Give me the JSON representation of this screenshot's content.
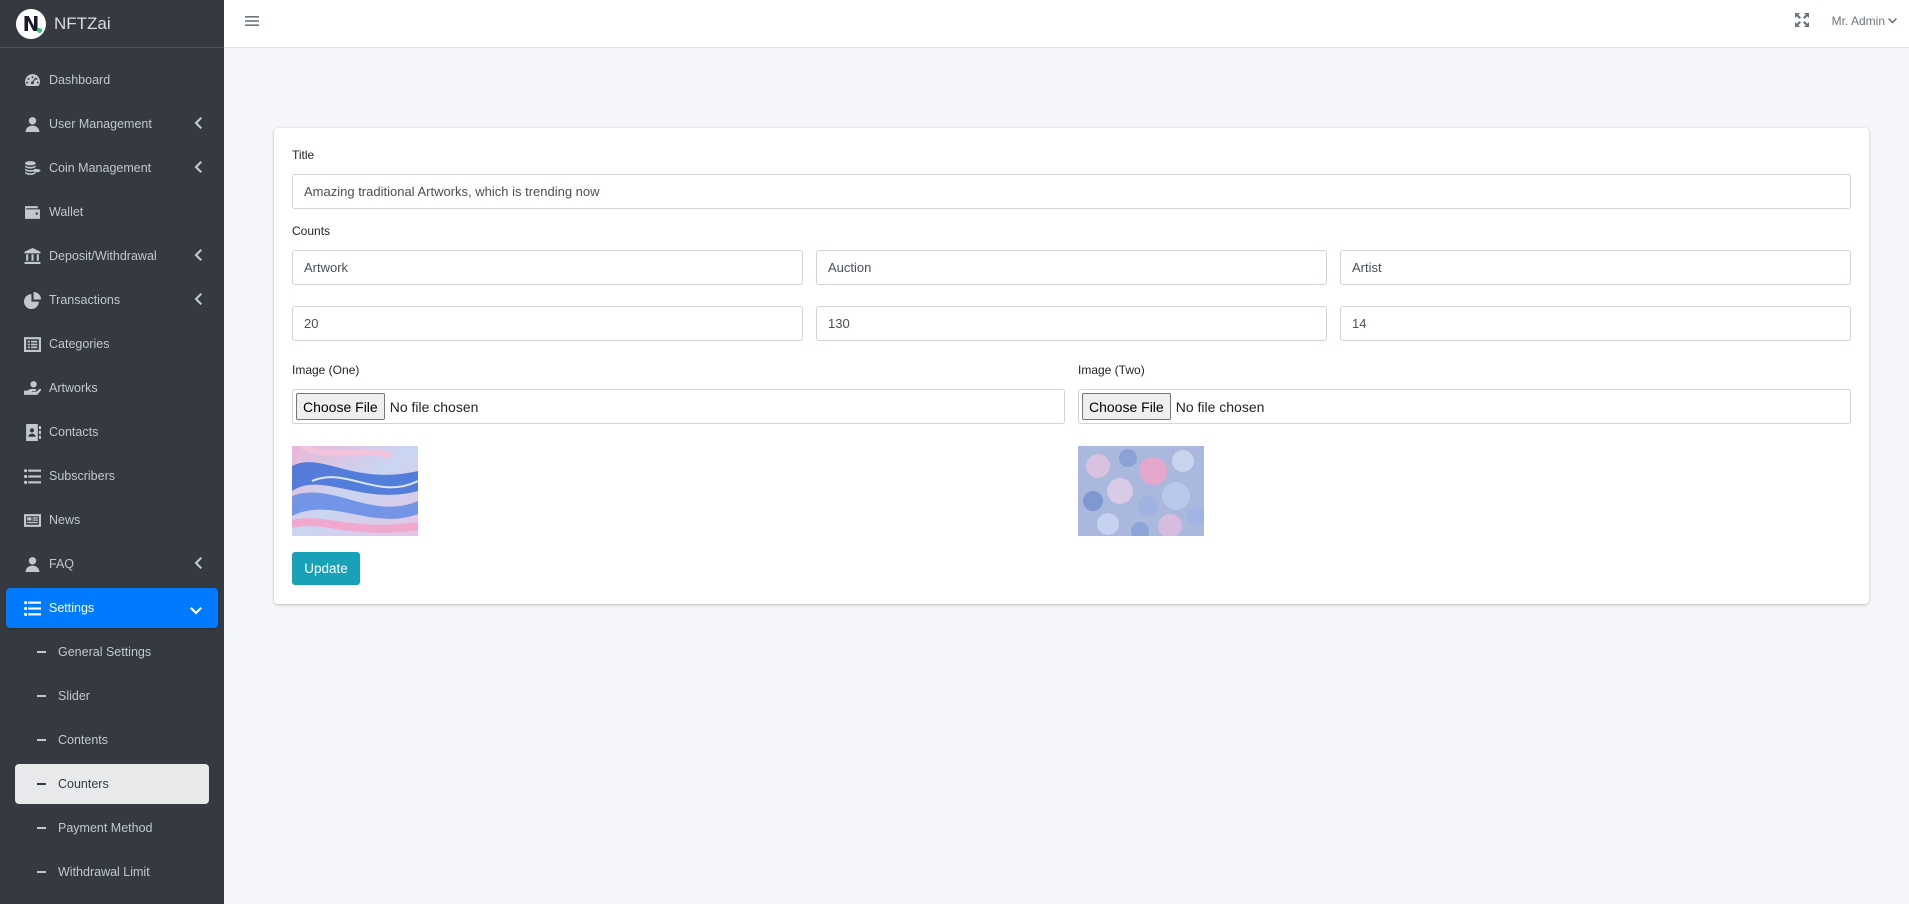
{
  "brand": {
    "logo_letter": "N",
    "name": "NFTZai"
  },
  "sidebar": {
    "items": [
      {
        "label": "Dashboard",
        "icon": "tachometer-icon",
        "has_arrow": false
      },
      {
        "label": "User Management",
        "icon": "user-icon",
        "has_arrow": true
      },
      {
        "label": "Coin Management",
        "icon": "coins-icon",
        "has_arrow": true
      },
      {
        "label": "Wallet",
        "icon": "wallet-icon",
        "has_arrow": false
      },
      {
        "label": "Deposit/Withdrawal",
        "icon": "bank-icon",
        "has_arrow": true
      },
      {
        "label": "Transactions",
        "icon": "pie-chart-icon",
        "has_arrow": true
      },
      {
        "label": "Categories",
        "icon": "list-alt-icon",
        "has_arrow": false
      },
      {
        "label": "Artworks",
        "icon": "hand-holding-icon",
        "has_arrow": false
      },
      {
        "label": "Contacts",
        "icon": "address-book-icon",
        "has_arrow": false
      },
      {
        "label": "Subscribers",
        "icon": "list-ul-icon",
        "has_arrow": false
      },
      {
        "label": "News",
        "icon": "newspaper-icon",
        "has_arrow": false
      },
      {
        "label": "FAQ",
        "icon": "user-icon",
        "has_arrow": true
      },
      {
        "label": "Settings",
        "icon": "list-ul-icon",
        "has_arrow": true,
        "active": true
      }
    ],
    "settings_sub": [
      {
        "label": "General Settings"
      },
      {
        "label": "Slider"
      },
      {
        "label": "Contents"
      },
      {
        "label": "Counters",
        "active": true
      },
      {
        "label": "Payment Method"
      },
      {
        "label": "Withdrawal Limit"
      }
    ]
  },
  "topbar": {
    "user_label": "Mr. Admin",
    "menu_icon": "bars-icon",
    "fullscreen_icon": "expand-arrows-icon"
  },
  "form": {
    "title_label": "Title",
    "title_value": "Amazing traditional Artworks, which is trending now",
    "counts_label": "Counts",
    "count_names": [
      "Artwork",
      "Auction",
      "Artist"
    ],
    "count_values": [
      "20",
      "130",
      "14"
    ],
    "image_one_label": "Image (One)",
    "image_two_label": "Image (Two)",
    "file_button_label": "Choose File",
    "file_status": "No file chosen",
    "update_label": "Update"
  },
  "colors": {
    "sidebar_bg": "#343a40",
    "active_blue": "#007bff",
    "update_teal": "#17a2b8",
    "page_bg": "#f4f6f9"
  }
}
